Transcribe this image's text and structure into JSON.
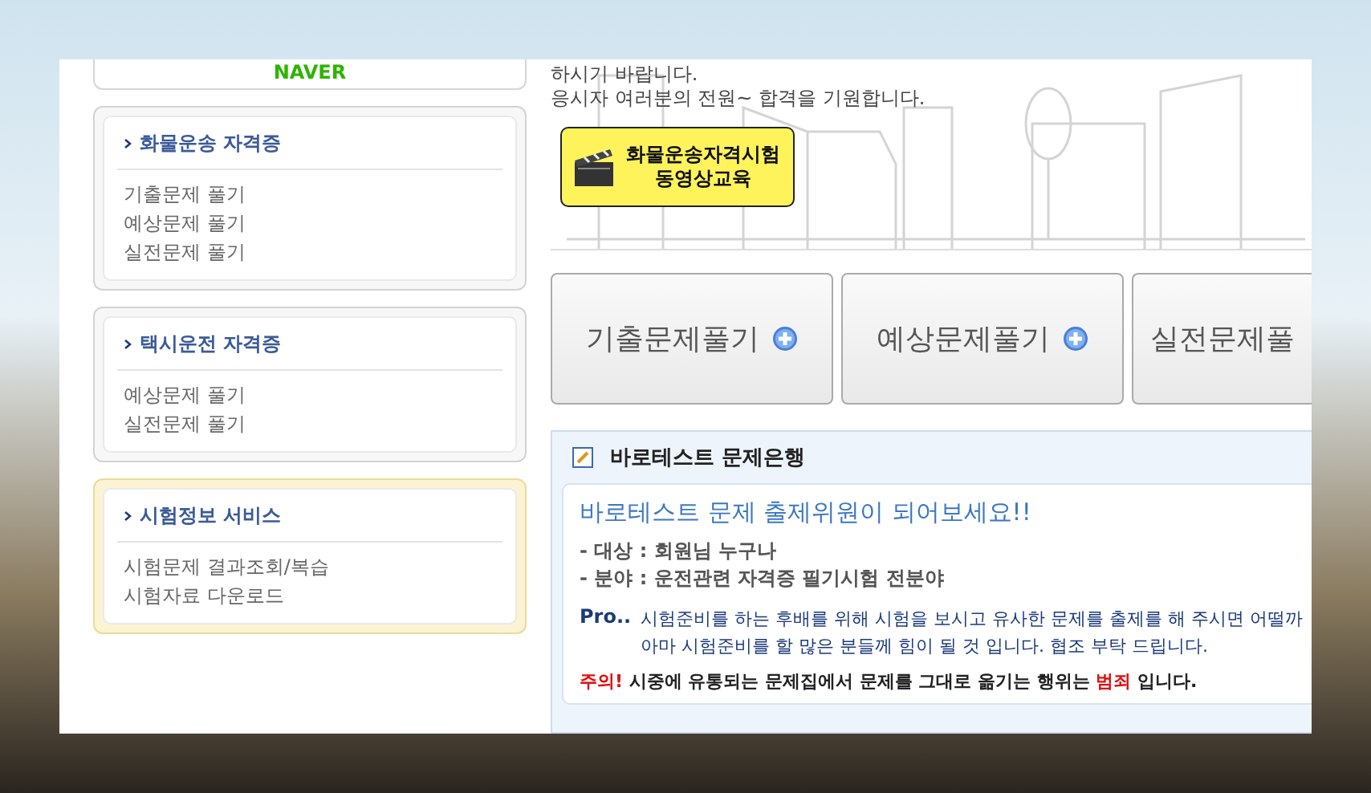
{
  "sidebar": {
    "logo": "NAVER",
    "sections": [
      {
        "title": "화물운송 자격증",
        "highlighted": false,
        "links": [
          "기출문제 풀기",
          "예상문제 풀기",
          "실전문제 풀기"
        ]
      },
      {
        "title": "택시운전 자격증",
        "highlighted": false,
        "links": [
          "예상문제 풀기",
          "실전문제 풀기"
        ]
      },
      {
        "title": "시험정보 서비스",
        "highlighted": true,
        "links": [
          "시험문제 결과조회/복습",
          "시험자료 다운로드"
        ]
      }
    ]
  },
  "intro": {
    "lines": [
      "하시기 바랍니다.",
      "응시자 여러분의 전원~ 합격을 기원합니다."
    ]
  },
  "video_button": {
    "lines": [
      "화물운송자격시험",
      "동영상교육"
    ]
  },
  "practice_buttons": [
    {
      "label": "기출문제풀기",
      "plus": true
    },
    {
      "label": "예상문제풀기",
      "plus": true
    },
    {
      "label": "실전문제풀",
      "plus": false
    }
  ],
  "question_bank": {
    "title": "바로테스트 문제은행",
    "headline": "바로테스트 문제 출제위원이 되어보세요!!",
    "details": [
      "- 대상 : 회원님 누구나",
      "- 분야 : 운전관련 자격증 필기시험 전분야"
    ],
    "pro_label": "Pro..",
    "pro_lines": [
      "시험준비를 하는 후배를 위해 시험을 보시고 유사한 문제를 출제를 해 주시면 어떨까",
      "아마 시험준비를 할 많은 분들께 힘이 될 것 입니다. 협조 부탁 드립니다."
    ],
    "warning": [
      {
        "kind": "alert",
        "text": "주의!"
      },
      {
        "kind": "normal",
        "text": "시중에 유통되는 문제집에서 문제를 그대로 옮기는 행위는"
      },
      {
        "kind": "alert",
        "text": "범죄"
      },
      {
        "kind": "normal",
        "text": "입니다."
      }
    ]
  }
}
